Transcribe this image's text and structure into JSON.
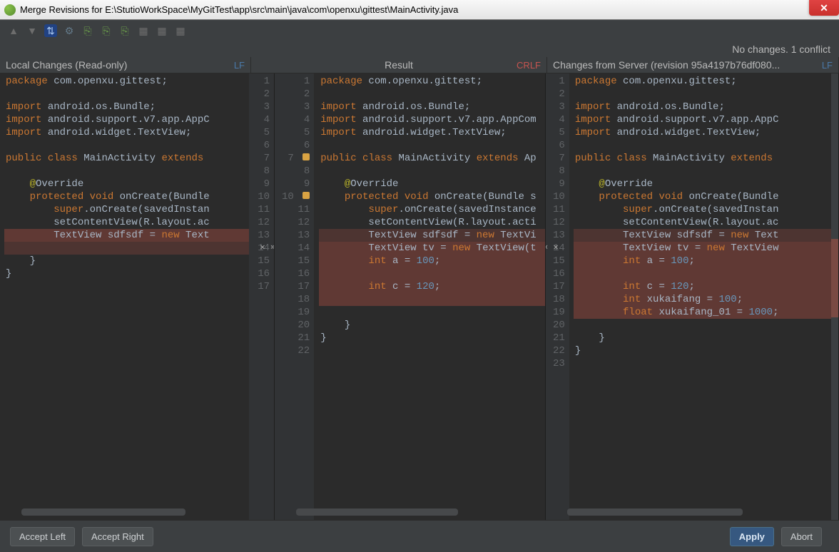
{
  "title": "Merge Revisions for E:\\StutioWorkSpace\\MyGitTest\\app\\src\\main\\java\\com\\openxu\\gittest\\MainActivity.java",
  "status": "No changes. 1 conflict",
  "headers": {
    "left_title": "Local Changes (Read-only)",
    "left_sep": "LF",
    "mid_title": "Result",
    "mid_sep": "CRLF",
    "right_title": "Changes from Server (revision 95a4197b76df080...",
    "right_sep": "LF"
  },
  "footer": {
    "accept_left": "Accept Left",
    "accept_right": "Accept Right",
    "apply": "Apply",
    "abort": "Abort"
  },
  "left_lines": [
    {
      "t": "package com.openxu.gittest;",
      "c": ""
    },
    {
      "t": "",
      "c": ""
    },
    {
      "t": "import android.os.Bundle;",
      "c": ""
    },
    {
      "t": "import android.support.v7.app.AppC",
      "c": ""
    },
    {
      "t": "import android.widget.TextView;",
      "c": ""
    },
    {
      "t": "",
      "c": ""
    },
    {
      "t": "public class MainActivity extends ",
      "c": ""
    },
    {
      "t": "",
      "c": ""
    },
    {
      "t": "    @Override",
      "c": ""
    },
    {
      "t": "    protected void onCreate(Bundle",
      "c": ""
    },
    {
      "t": "        super.onCreate(savedInstan",
      "c": ""
    },
    {
      "t": "        setContentView(R.layout.ac",
      "c": ""
    },
    {
      "t": "        TextView sdfsdf = new Text",
      "c": "conflict-d"
    },
    {
      "t": "",
      "c": "conflict-l"
    },
    {
      "t": "    }",
      "c": ""
    },
    {
      "t": "}",
      "c": ""
    }
  ],
  "mid_lines": [
    {
      "n": 1,
      "t": "package com.openxu.gittest;",
      "c": ""
    },
    {
      "n": 2,
      "t": "",
      "c": ""
    },
    {
      "n": 3,
      "t": "import android.os.Bundle;",
      "c": ""
    },
    {
      "n": 4,
      "t": "import android.support.v7.app.AppCom",
      "c": ""
    },
    {
      "n": 5,
      "t": "import android.widget.TextView;",
      "c": ""
    },
    {
      "n": 6,
      "t": "",
      "c": ""
    },
    {
      "n": 7,
      "t": "public class MainActivity extends Ap",
      "c": ""
    },
    {
      "n": 8,
      "t": "",
      "c": ""
    },
    {
      "n": 9,
      "t": "    @Override",
      "c": ""
    },
    {
      "n": 10,
      "t": "    protected void onCreate(Bundle s",
      "c": ""
    },
    {
      "n": 11,
      "t": "        super.onCreate(savedInstance",
      "c": ""
    },
    {
      "n": 12,
      "t": "        setContentView(R.layout.acti",
      "c": ""
    },
    {
      "n": 13,
      "t": "        TextView sdfsdf = new TextVi",
      "c": "conflict-l"
    },
    {
      "n": 14,
      "t": "        TextView tv = new TextView(t",
      "c": "conflict-d"
    },
    {
      "n": 15,
      "t": "        int a = 100;",
      "c": "conflict-d"
    },
    {
      "n": 16,
      "t": "",
      "c": "conflict-d"
    },
    {
      "n": 17,
      "t": "        int c = 120;",
      "c": "conflict-d"
    },
    {
      "n": 18,
      "t": "",
      "c": "conflict-d"
    },
    {
      "n": 19,
      "t": "",
      "c": ""
    },
    {
      "n": 20,
      "t": "    }",
      "c": ""
    },
    {
      "n": 21,
      "t": "}",
      "c": ""
    },
    {
      "n": 22,
      "t": "",
      "c": ""
    }
  ],
  "right_lines": [
    {
      "n": 1,
      "t": "package com.openxu.gittest;",
      "c": ""
    },
    {
      "n": 2,
      "t": "",
      "c": ""
    },
    {
      "n": 3,
      "t": "import android.os.Bundle;",
      "c": ""
    },
    {
      "n": 4,
      "t": "import android.support.v7.app.AppC",
      "c": ""
    },
    {
      "n": 5,
      "t": "import android.widget.TextView;",
      "c": ""
    },
    {
      "n": 6,
      "t": "",
      "c": ""
    },
    {
      "n": 7,
      "t": "public class MainActivity extends ",
      "c": ""
    },
    {
      "n": 8,
      "t": "",
      "c": ""
    },
    {
      "n": 9,
      "t": "    @Override",
      "c": ""
    },
    {
      "n": 10,
      "t": "    protected void onCreate(Bundle",
      "c": ""
    },
    {
      "n": 11,
      "t": "        super.onCreate(savedInstan",
      "c": ""
    },
    {
      "n": 12,
      "t": "        setContentView(R.layout.ac",
      "c": ""
    },
    {
      "n": 13,
      "t": "        TextView sdfsdf = new Text",
      "c": "conflict-l"
    },
    {
      "n": 14,
      "t": "        TextView tv = new TextView",
      "c": "conflict-d"
    },
    {
      "n": 15,
      "t": "        int a = 100;",
      "c": "conflict-d"
    },
    {
      "n": 16,
      "t": "",
      "c": "conflict-d"
    },
    {
      "n": 17,
      "t": "        int c = 120;",
      "c": "conflict-d"
    },
    {
      "n": 18,
      "t": "        int xukaifang = 100;",
      "c": "conflict-d"
    },
    {
      "n": 19,
      "t": "        float xukaifang_01 = 1000;",
      "c": "conflict-d"
    },
    {
      "n": 20,
      "t": "",
      "c": ""
    },
    {
      "n": 21,
      "t": "    }",
      "c": ""
    },
    {
      "n": 22,
      "t": "}",
      "c": ""
    },
    {
      "n": 23,
      "t": "",
      "c": ""
    }
  ],
  "left_gutter_count": 16,
  "mid_gutter_a": [
    1,
    2,
    3,
    4,
    5,
    6,
    7,
    8,
    9,
    10,
    11,
    12,
    13,
    14,
    15,
    16,
    17
  ],
  "mid_gutter_b": [
    1,
    2,
    3,
    4,
    5,
    6,
    7,
    8,
    9,
    10,
    11,
    12,
    13,
    14,
    15,
    16,
    17,
    18,
    19,
    20,
    21,
    22
  ]
}
